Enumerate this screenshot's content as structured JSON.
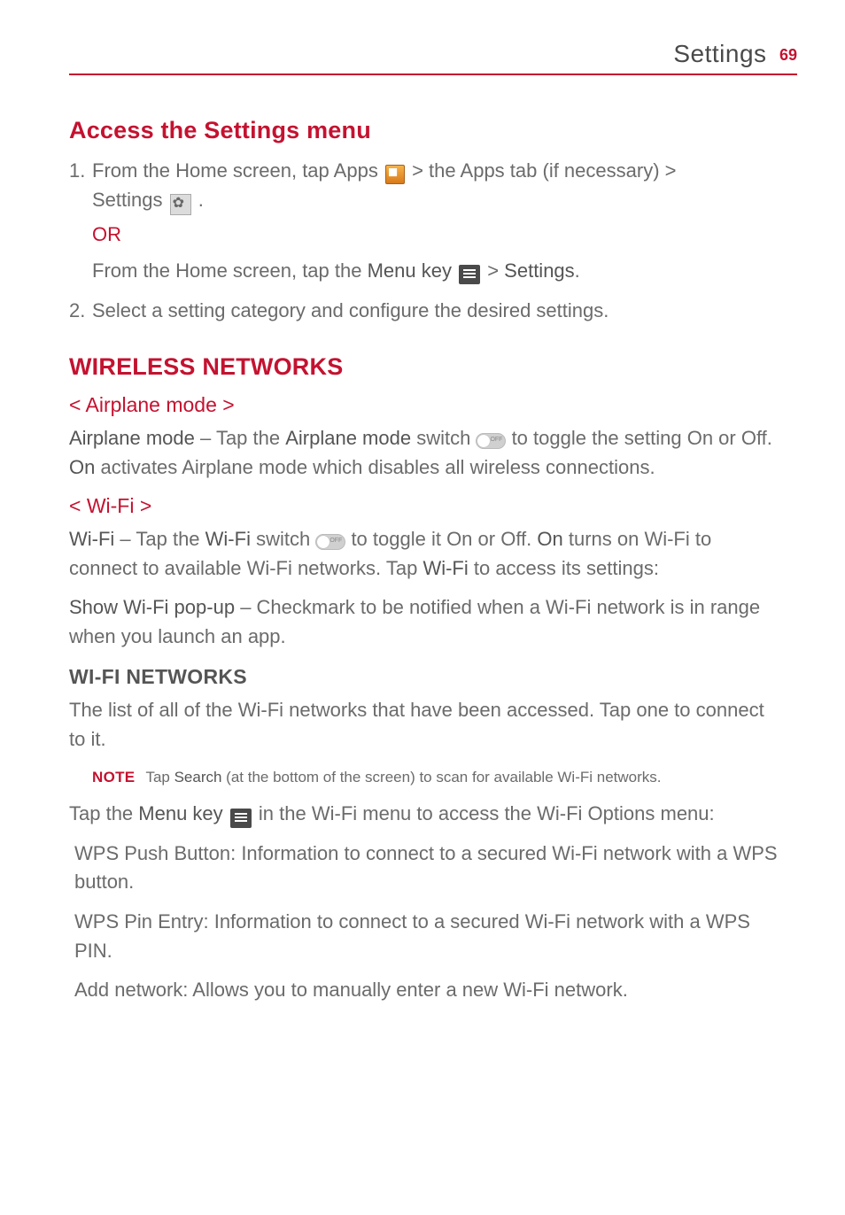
{
  "header": {
    "section": "Settings",
    "page_number": "69"
  },
  "section1": {
    "title": "Access the Settings menu",
    "step1_a": "1.",
    "step1_b": "From the Home screen, tap ",
    "step1_apps": "Apps",
    "step1_c": " > the ",
    "step1_appstab": "Apps",
    "step1_d": " tab (if necessary) > ",
    "step1_settings": "Settings",
    "step1_e": " .",
    "or": "OR",
    "alt_a": "From the Home screen, tap the ",
    "alt_menu": "Menu key",
    "alt_b": " > ",
    "alt_settings": "Settings",
    "alt_c": ".",
    "step2_a": "2.",
    "step2_b": "Select a setting category and configure the desired settings."
  },
  "section2": {
    "title": "WIRELESS NETWORKS",
    "airplane": {
      "heading": "< Airplane mode >",
      "b1": "Airplane mode",
      "t1": " – Tap the ",
      "b2": "Airplane mode",
      "t2": " switch ",
      "t3": " to toggle the setting On or Off. ",
      "b3": "On",
      "t4": " activates Airplane mode which disables all wireless connections."
    },
    "wifi": {
      "heading": "< Wi-Fi >",
      "b1": "Wi-Fi",
      "t1": " – Tap the ",
      "b2": "Wi-Fi",
      "t2": " switch ",
      "t3": " to toggle it On or Off. ",
      "b3": "On",
      "t4": " turns on Wi-Fi to connect to available Wi-Fi networks. Tap ",
      "b4": "Wi-Fi",
      "t5": " to access its settings:",
      "p2b": "Show Wi-Fi pop-up",
      "p2t": " – Checkmark to be notified when a Wi-Fi network is in range when you launch an app."
    },
    "wifinet": {
      "heading": "WI-FI NETWORKS",
      "p1": "The list of all of the Wi-Fi networks that have been accessed. Tap one to connect to it.",
      "note_label": "NOTE",
      "note_a": "Tap ",
      "note_b": "Search",
      "note_c": " (at the bottom of the screen) to scan for available Wi-Fi networks.",
      "p2a": "Tap the ",
      "p2b": "Menu key",
      "p2c": " in the Wi-Fi menu to access the Wi-Fi Options menu:",
      "i1b": "WPS Push Button",
      "i1t": ": Information to connect to a secured Wi-Fi network with a WPS button.",
      "i2b": "WPS Pin Entry",
      "i2t": ": Information to connect to a secured Wi-Fi network with a WPS PIN.",
      "i3b": "Add network",
      "i3t": ": Allows you to manually enter a new Wi-Fi network."
    }
  }
}
